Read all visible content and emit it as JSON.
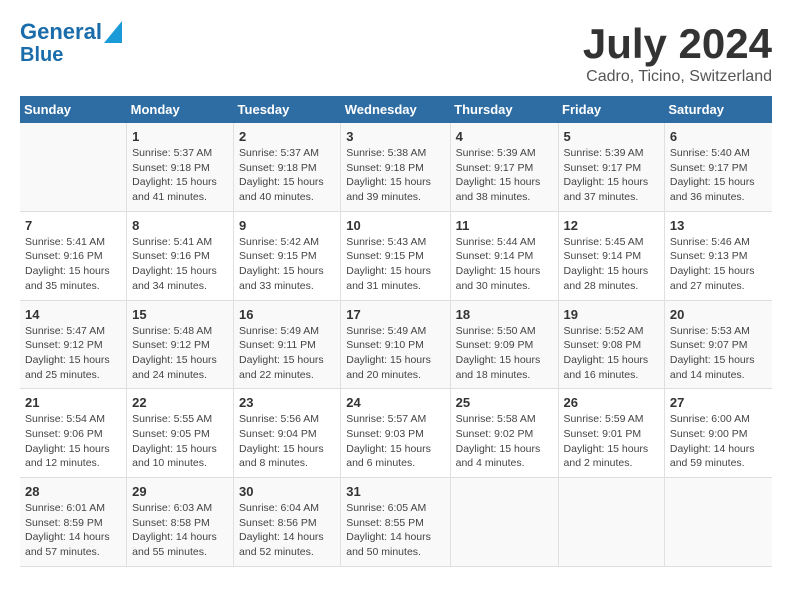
{
  "header": {
    "logo_line1": "General",
    "logo_line2": "Blue",
    "title": "July 2024",
    "subtitle": "Cadro, Ticino, Switzerland"
  },
  "columns": [
    "Sunday",
    "Monday",
    "Tuesday",
    "Wednesday",
    "Thursday",
    "Friday",
    "Saturday"
  ],
  "weeks": [
    [
      {
        "day": "",
        "info": ""
      },
      {
        "day": "1",
        "info": "Sunrise: 5:37 AM\nSunset: 9:18 PM\nDaylight: 15 hours\nand 41 minutes."
      },
      {
        "day": "2",
        "info": "Sunrise: 5:37 AM\nSunset: 9:18 PM\nDaylight: 15 hours\nand 40 minutes."
      },
      {
        "day": "3",
        "info": "Sunrise: 5:38 AM\nSunset: 9:18 PM\nDaylight: 15 hours\nand 39 minutes."
      },
      {
        "day": "4",
        "info": "Sunrise: 5:39 AM\nSunset: 9:17 PM\nDaylight: 15 hours\nand 38 minutes."
      },
      {
        "day": "5",
        "info": "Sunrise: 5:39 AM\nSunset: 9:17 PM\nDaylight: 15 hours\nand 37 minutes."
      },
      {
        "day": "6",
        "info": "Sunrise: 5:40 AM\nSunset: 9:17 PM\nDaylight: 15 hours\nand 36 minutes."
      }
    ],
    [
      {
        "day": "7",
        "info": "Sunrise: 5:41 AM\nSunset: 9:16 PM\nDaylight: 15 hours\nand 35 minutes."
      },
      {
        "day": "8",
        "info": "Sunrise: 5:41 AM\nSunset: 9:16 PM\nDaylight: 15 hours\nand 34 minutes."
      },
      {
        "day": "9",
        "info": "Sunrise: 5:42 AM\nSunset: 9:15 PM\nDaylight: 15 hours\nand 33 minutes."
      },
      {
        "day": "10",
        "info": "Sunrise: 5:43 AM\nSunset: 9:15 PM\nDaylight: 15 hours\nand 31 minutes."
      },
      {
        "day": "11",
        "info": "Sunrise: 5:44 AM\nSunset: 9:14 PM\nDaylight: 15 hours\nand 30 minutes."
      },
      {
        "day": "12",
        "info": "Sunrise: 5:45 AM\nSunset: 9:14 PM\nDaylight: 15 hours\nand 28 minutes."
      },
      {
        "day": "13",
        "info": "Sunrise: 5:46 AM\nSunset: 9:13 PM\nDaylight: 15 hours\nand 27 minutes."
      }
    ],
    [
      {
        "day": "14",
        "info": "Sunrise: 5:47 AM\nSunset: 9:12 PM\nDaylight: 15 hours\nand 25 minutes."
      },
      {
        "day": "15",
        "info": "Sunrise: 5:48 AM\nSunset: 9:12 PM\nDaylight: 15 hours\nand 24 minutes."
      },
      {
        "day": "16",
        "info": "Sunrise: 5:49 AM\nSunset: 9:11 PM\nDaylight: 15 hours\nand 22 minutes."
      },
      {
        "day": "17",
        "info": "Sunrise: 5:49 AM\nSunset: 9:10 PM\nDaylight: 15 hours\nand 20 minutes."
      },
      {
        "day": "18",
        "info": "Sunrise: 5:50 AM\nSunset: 9:09 PM\nDaylight: 15 hours\nand 18 minutes."
      },
      {
        "day": "19",
        "info": "Sunrise: 5:52 AM\nSunset: 9:08 PM\nDaylight: 15 hours\nand 16 minutes."
      },
      {
        "day": "20",
        "info": "Sunrise: 5:53 AM\nSunset: 9:07 PM\nDaylight: 15 hours\nand 14 minutes."
      }
    ],
    [
      {
        "day": "21",
        "info": "Sunrise: 5:54 AM\nSunset: 9:06 PM\nDaylight: 15 hours\nand 12 minutes."
      },
      {
        "day": "22",
        "info": "Sunrise: 5:55 AM\nSunset: 9:05 PM\nDaylight: 15 hours\nand 10 minutes."
      },
      {
        "day": "23",
        "info": "Sunrise: 5:56 AM\nSunset: 9:04 PM\nDaylight: 15 hours\nand 8 minutes."
      },
      {
        "day": "24",
        "info": "Sunrise: 5:57 AM\nSunset: 9:03 PM\nDaylight: 15 hours\nand 6 minutes."
      },
      {
        "day": "25",
        "info": "Sunrise: 5:58 AM\nSunset: 9:02 PM\nDaylight: 15 hours\nand 4 minutes."
      },
      {
        "day": "26",
        "info": "Sunrise: 5:59 AM\nSunset: 9:01 PM\nDaylight: 15 hours\nand 2 minutes."
      },
      {
        "day": "27",
        "info": "Sunrise: 6:00 AM\nSunset: 9:00 PM\nDaylight: 14 hours\nand 59 minutes."
      }
    ],
    [
      {
        "day": "28",
        "info": "Sunrise: 6:01 AM\nSunset: 8:59 PM\nDaylight: 14 hours\nand 57 minutes."
      },
      {
        "day": "29",
        "info": "Sunrise: 6:03 AM\nSunset: 8:58 PM\nDaylight: 14 hours\nand 55 minutes."
      },
      {
        "day": "30",
        "info": "Sunrise: 6:04 AM\nSunset: 8:56 PM\nDaylight: 14 hours\nand 52 minutes."
      },
      {
        "day": "31",
        "info": "Sunrise: 6:05 AM\nSunset: 8:55 PM\nDaylight: 14 hours\nand 50 minutes."
      },
      {
        "day": "",
        "info": ""
      },
      {
        "day": "",
        "info": ""
      },
      {
        "day": "",
        "info": ""
      }
    ]
  ]
}
